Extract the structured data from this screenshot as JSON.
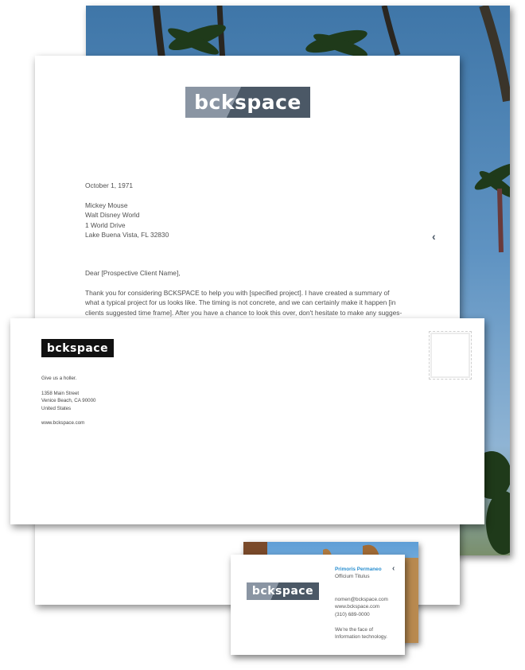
{
  "logo": {
    "text": "bckspace"
  },
  "letter": {
    "date": "October 1, 1971",
    "address": [
      "Mickey Mouse",
      "Walt Disney World",
      "1 World Drive",
      "Lake Buena Vista, FL 32830"
    ],
    "salutation": "Dear [Prospective Client Name],",
    "body_lines": [
      "Thank you for considering BCKSPACE to help you with [specified project].    I have created a summary of",
      "what a typical project for us looks like.   The timing is not concrete, and we can certainly make it happen [in",
      "clients suggested time frame].    After you have a chance to look this over, don't hesitate to make any sugges-"
    ],
    "chevron": "‹"
  },
  "envelope": {
    "tagline": "Give us a holler.",
    "address": [
      "1358 Main Street",
      "Venice Beach, CA 90000",
      "United States"
    ],
    "website": "www.bckspace.com"
  },
  "card": {
    "name": "Primoris Permaneo",
    "title": "Officium Titulus",
    "email": "nomen@bckspace.com",
    "website": "www.bckspace.com",
    "phone": "(310) 689-0000",
    "slogan": [
      "We're the face of",
      "Information technology."
    ],
    "chevron": "‹"
  },
  "colors": {
    "brand_gray": "#8a95a3",
    "brand_dark": "#4b5866",
    "accent_blue": "#2a8fd0"
  }
}
